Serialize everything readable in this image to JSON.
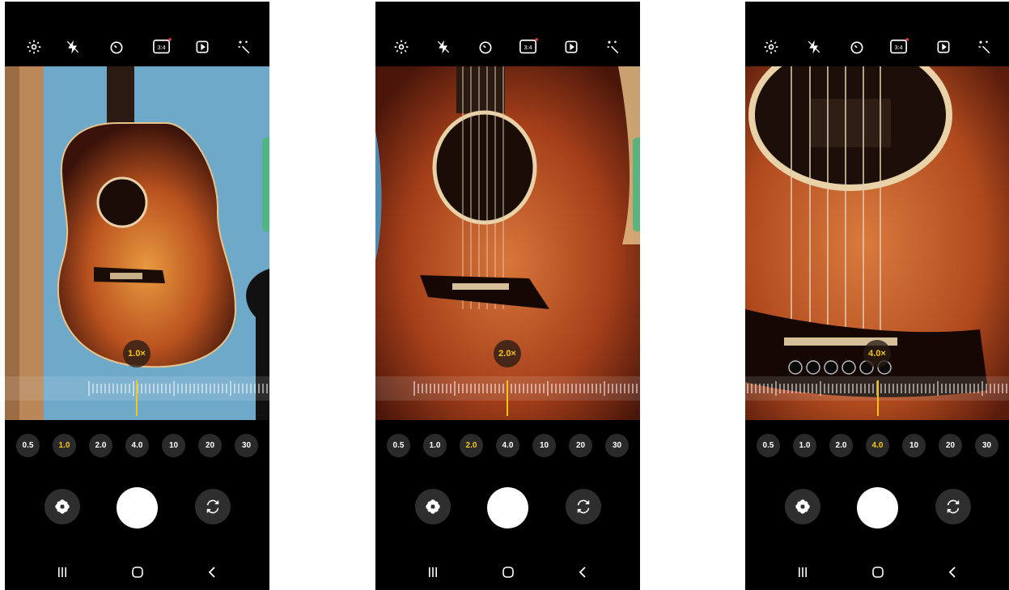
{
  "toolbar": {
    "aspect_ratio": "3:4",
    "icons": [
      "gear-icon",
      "flash-off-icon",
      "timer-icon",
      "aspect-ratio-icon",
      "motion-photo-icon",
      "filters-icon"
    ]
  },
  "zoom_levels": [
    "0.5",
    "1.0",
    "2.0",
    "4.0",
    "10",
    "20",
    "30"
  ],
  "screens": [
    {
      "zoom_label": "1.0×",
      "selected_zoom": "1.0"
    },
    {
      "zoom_label": "2.0×",
      "selected_zoom": "2.0"
    },
    {
      "zoom_label": "4.0×",
      "selected_zoom": "4.0"
    }
  ],
  "colors": {
    "accent": "#f5c518",
    "side_tab": "#4fb57c",
    "background": "#000000"
  }
}
